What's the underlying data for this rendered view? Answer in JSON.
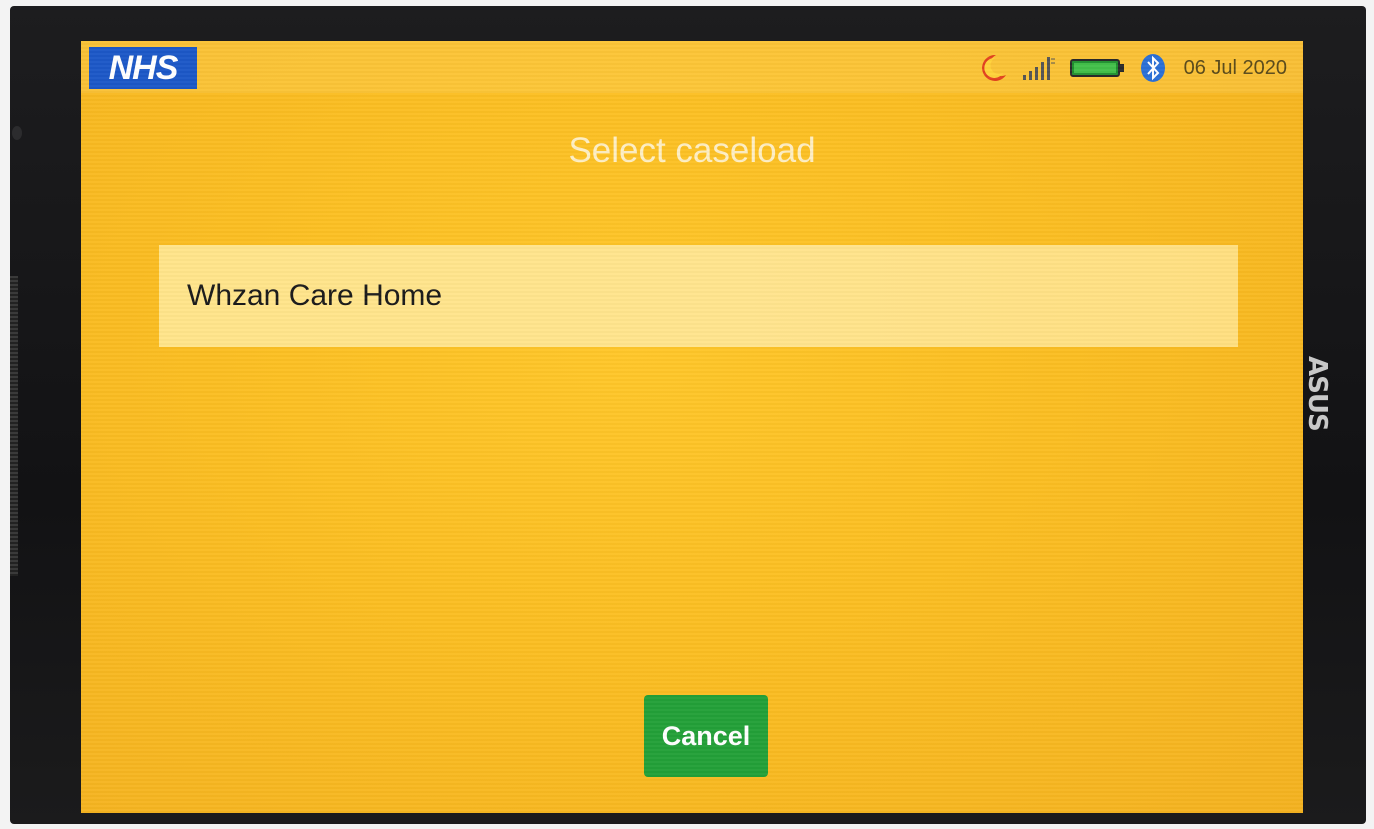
{
  "status_bar": {
    "logo_text": "NHS",
    "date": "06 Jul 2020",
    "icons": [
      "moon-icon",
      "signal-icon",
      "battery-icon",
      "bluetooth-icon"
    ]
  },
  "device": {
    "brand": "ASUS"
  },
  "screen": {
    "title": "Select caseload",
    "caseloads": [
      {
        "label": "Whzan Care Home"
      }
    ],
    "cancel_label": "Cancel"
  },
  "colors": {
    "background": "#fbbe22",
    "item_highlight": "#ffe48a",
    "cancel_button": "#23a038",
    "nhs_blue": "#1c58c7"
  }
}
